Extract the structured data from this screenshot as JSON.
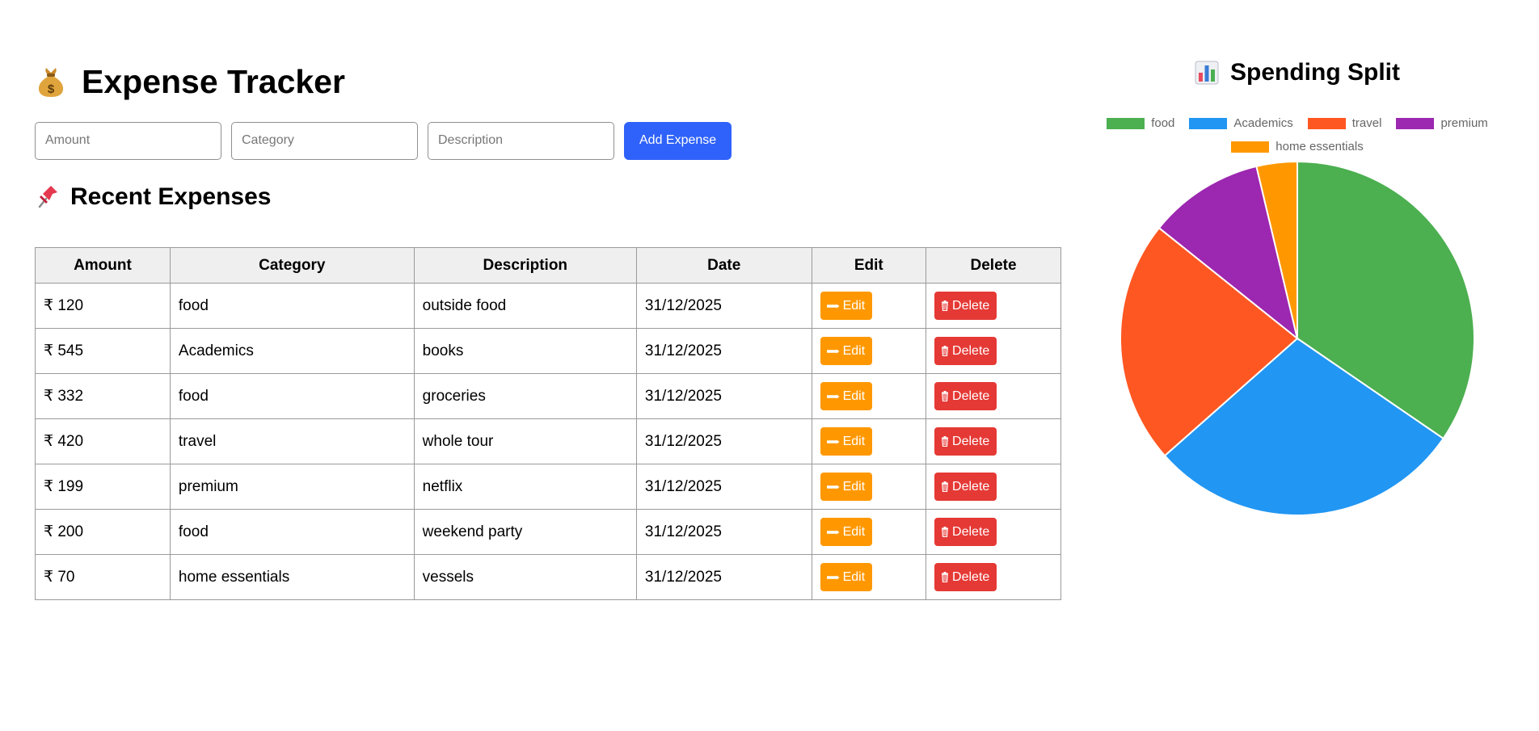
{
  "header": {
    "title": "Expense Tracker",
    "title_icon": "money-bag-icon"
  },
  "form": {
    "amount_placeholder": "Amount",
    "category_placeholder": "Category",
    "description_placeholder": "Description",
    "add_label": "Add Expense"
  },
  "recent": {
    "title": "Recent Expenses",
    "title_icon": "pushpin-icon"
  },
  "table": {
    "headers": [
      "Amount",
      "Category",
      "Description",
      "Date",
      "Edit",
      "Delete"
    ],
    "edit_label": "Edit",
    "delete_label": "Delete",
    "rows": [
      {
        "amount": "₹ 120",
        "category": "food",
        "description": "outside food",
        "date": "31/12/2025"
      },
      {
        "amount": "₹ 545",
        "category": "Academics",
        "description": "books",
        "date": "31/12/2025"
      },
      {
        "amount": "₹ 332",
        "category": "food",
        "description": "groceries",
        "date": "31/12/2025"
      },
      {
        "amount": "₹ 420",
        "category": "travel",
        "description": "whole tour",
        "date": "31/12/2025"
      },
      {
        "amount": "₹ 199",
        "category": "premium",
        "description": "netflix",
        "date": "31/12/2025"
      },
      {
        "amount": "₹ 200",
        "category": "food",
        "description": "weekend party",
        "date": "31/12/2025"
      },
      {
        "amount": "₹ 70",
        "category": "home essentials",
        "description": "vessels",
        "date": "31/12/2025"
      }
    ]
  },
  "chart": {
    "title": "Spending Split",
    "title_icon": "bar-chart-icon"
  },
  "chart_data": {
    "type": "pie",
    "categories": [
      "food",
      "Academics",
      "travel",
      "premium",
      "home essentials"
    ],
    "values": [
      652,
      545,
      420,
      199,
      70
    ],
    "colors": [
      "#4caf50",
      "#2196f3",
      "#ff5722",
      "#9c27b0",
      "#ff9800"
    ],
    "legend_position": "top"
  },
  "colors": {
    "accent": "#2f62fa",
    "edit": "#ff9800",
    "delete": "#e53935",
    "header_bg": "#efefef"
  }
}
